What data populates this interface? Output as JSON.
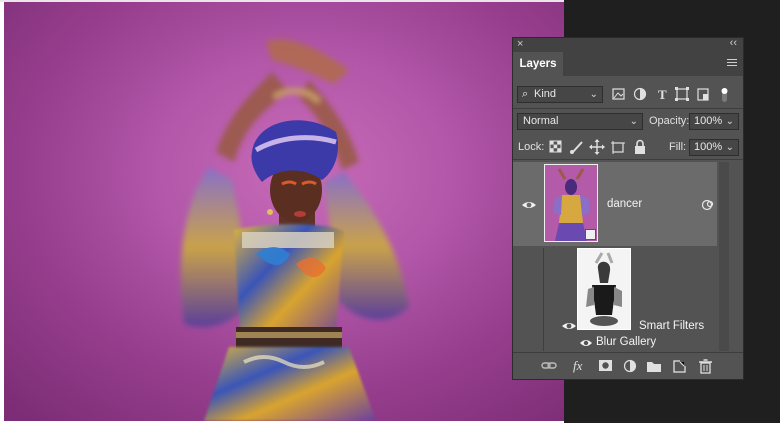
{
  "panel": {
    "close_glyph": "×",
    "collapse_glyph": "‹‹",
    "tab_label": "Layers",
    "filter": {
      "kind_label": "Kind",
      "search_glyph": "⌕"
    },
    "blend_mode": "Normal",
    "opacity_label": "Opacity:",
    "opacity_value": "100%",
    "lock_label": "Lock:",
    "fill_label": "Fill:",
    "fill_value": "100%",
    "filter_icons": [
      "image-filter-icon",
      "adjustment-filter-icon",
      "type-filter-icon",
      "shape-filter-icon",
      "smart-object-filter-icon",
      "filter-toggle-icon"
    ],
    "lock_icons": [
      "lock-transparent-icon",
      "lock-pixels-icon",
      "lock-position-icon",
      "lock-artboard-icon",
      "lock-all-icon"
    ],
    "layers": [
      {
        "name": "dancer",
        "visible": true,
        "selected": true
      }
    ],
    "smart_filters_label": "Smart Filters",
    "filter_effect": "Blur Gallery",
    "type_icon_glyph": "T",
    "fx_glyph": "fx",
    "bottom_icons": [
      "link-layers-icon",
      "fx-icon",
      "add-mask-icon",
      "adjustment-layer-icon",
      "new-group-icon",
      "new-layer-icon",
      "delete-layer-icon"
    ]
  },
  "colors": {
    "panel_bg": "#535353",
    "selected_layer": "#6b6b6b",
    "photo_bg": "#b257a9",
    "dark_bg": "#1f1f1f"
  }
}
